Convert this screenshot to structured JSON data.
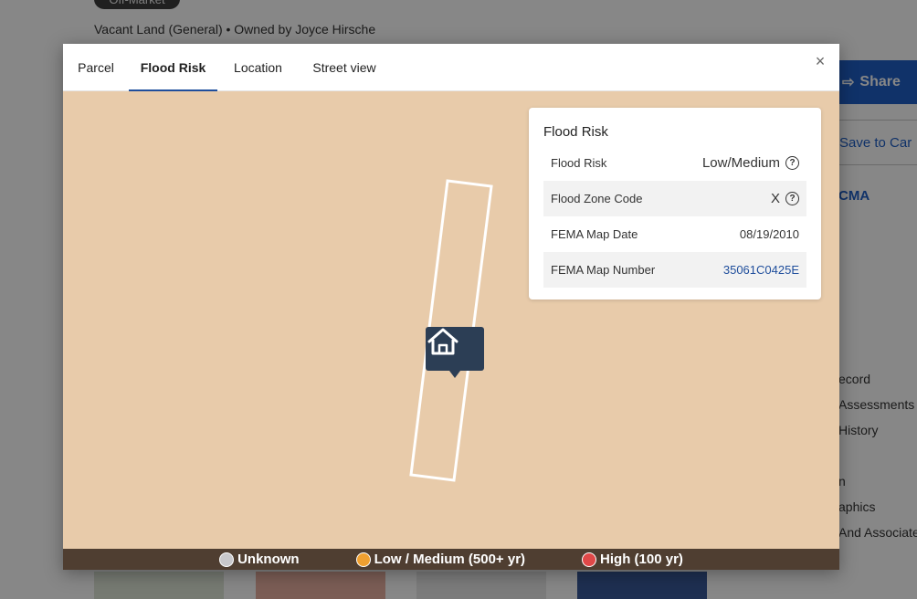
{
  "background": {
    "status_pill": "Off-Market",
    "subtitle": "Vacant Land (General) • Owned by Joyce Hirsche",
    "share_label": "Share",
    "save_label": "Save to Car",
    "cma_label": "CMA",
    "side_links": [
      "ecord",
      "Assessments",
      "History",
      "n",
      "aphics",
      "And Associate"
    ]
  },
  "modal": {
    "tabs": [
      {
        "label": "Parcel"
      },
      {
        "label": "Flood Risk"
      },
      {
        "label": "Location"
      },
      {
        "label": "Street view"
      }
    ],
    "close_label": "×"
  },
  "flood_card": {
    "title": "Flood Risk",
    "rows": [
      {
        "label": "Flood Risk",
        "value": "Low/Medium"
      },
      {
        "label": "Flood Zone Code",
        "value": "X"
      },
      {
        "label": "FEMA Map Date",
        "value": "08/19/2010"
      },
      {
        "label": "FEMA Map Number",
        "value": "35061C0425E"
      }
    ],
    "help_symbol": "?"
  },
  "legend": {
    "items": [
      {
        "label": "Unknown",
        "color": "#c8c8cc"
      },
      {
        "label": "Low / Medium (500+ yr)",
        "color": "#f0a030"
      },
      {
        "label": "High (100 yr)",
        "color": "#e04848"
      }
    ]
  },
  "colors": {
    "map_fill": "#e8cbaa",
    "pin": "#2c3e55",
    "accent": "#1f4e9c",
    "legend_bar": "#4f3e31"
  }
}
